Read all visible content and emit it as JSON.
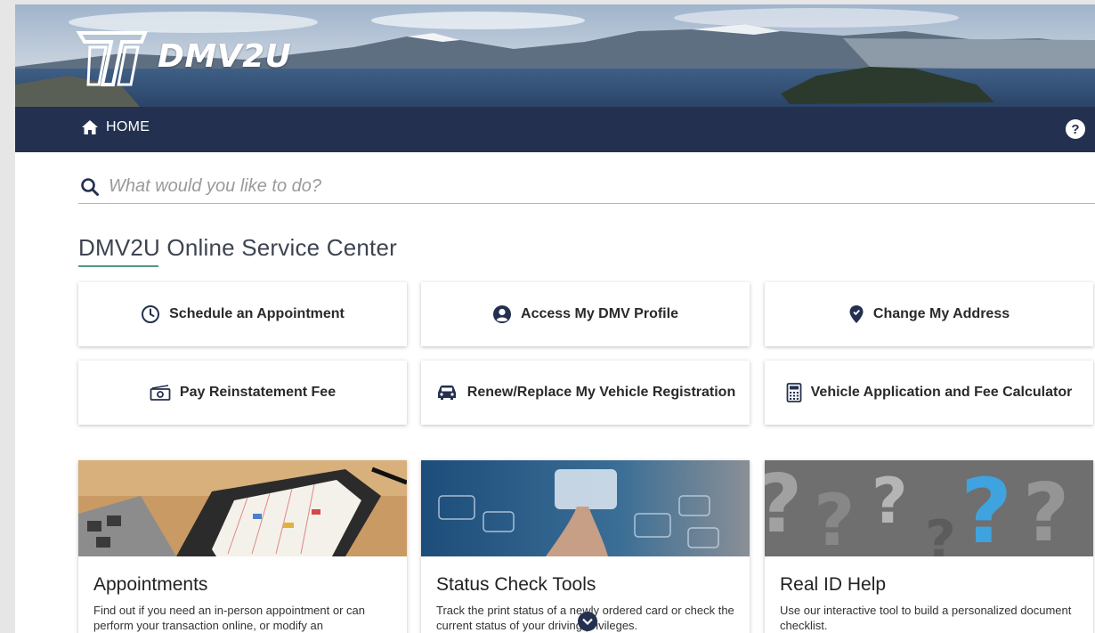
{
  "brand": {
    "name": "DMV2U"
  },
  "nav": {
    "home_label": "HOME",
    "help_label": "?"
  },
  "search": {
    "placeholder": "What would you like to do?",
    "value": ""
  },
  "section": {
    "title": "DMV2U Online Service Center"
  },
  "services": [
    {
      "label": "Schedule an Appointment",
      "icon": "clock-icon"
    },
    {
      "label": "Access My DMV Profile",
      "icon": "user-circle-icon"
    },
    {
      "label": "Change My Address",
      "icon": "map-pin-icon"
    },
    {
      "label": "Pay Reinstatement Fee",
      "icon": "money-bill-icon"
    },
    {
      "label": "Renew/Replace My Vehicle Registration",
      "icon": "car-icon"
    },
    {
      "label": "Vehicle Application and Fee Calculator",
      "icon": "calculator-icon"
    }
  ],
  "cards": [
    {
      "title": "Appointments",
      "text": "Find out if you need an in-person appointment or can perform your transaction online, or modify an",
      "image": "tablet-calendar-photo"
    },
    {
      "title": "Status Check Tools",
      "text": "Track the print status of a newly ordered card or check the current status of your driving privileges.",
      "image": "touchscreen-hand-photo"
    },
    {
      "title": "Real ID Help",
      "text": "Use our interactive tool to build a personalized document checklist.",
      "image": "question-marks-photo"
    }
  ],
  "colors": {
    "nav_bg": "#23304f",
    "accent_underline": "#4e9a82",
    "page_bg": "#ffffff",
    "outer_bg": "#e6e6e6"
  }
}
